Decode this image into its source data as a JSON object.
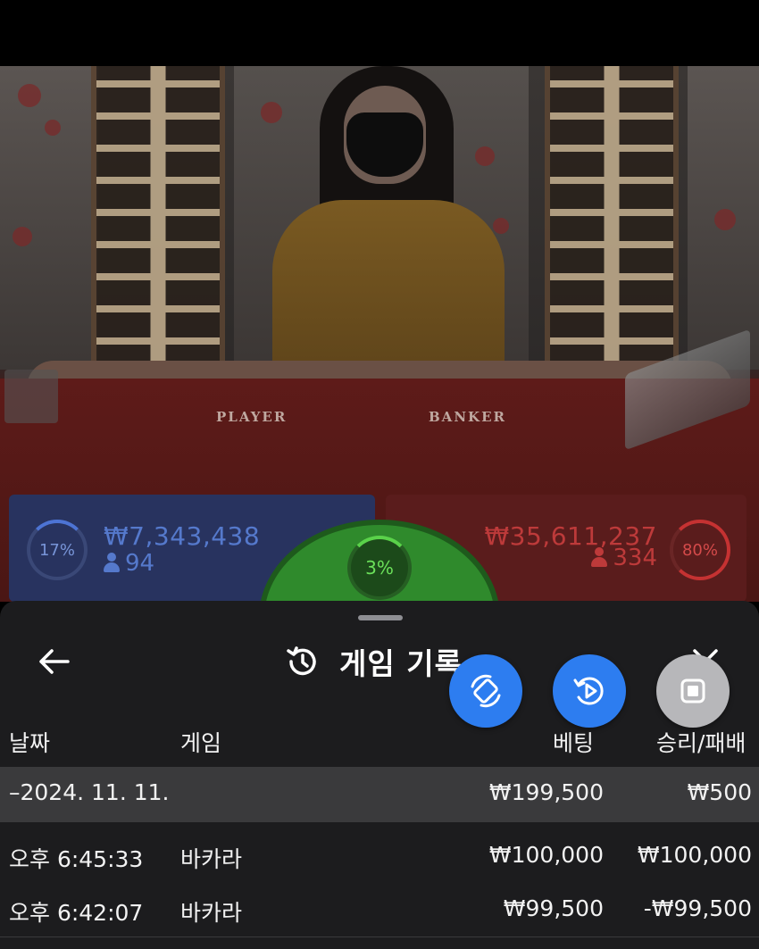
{
  "table": {
    "player_label": "PLAYER",
    "banker_label": "BANKER"
  },
  "bets": {
    "player": {
      "percent_label": "17%",
      "percent": 17,
      "amount": "₩7,343,438",
      "players": "94",
      "color": "#5579cc"
    },
    "tie": {
      "percent_label": "3%",
      "percent": 3,
      "color": "#6be05a"
    },
    "banker": {
      "percent_label": "80%",
      "percent": 80,
      "amount": "₩35,611,237",
      "players": "334",
      "color": "#bd3a3a"
    }
  },
  "sheet": {
    "title": "게임 기록",
    "icons": {
      "back": "arrow-left-icon",
      "history": "history-icon",
      "close": "close-icon",
      "fab1": "rotate-device-icon",
      "fab2": "replay-video-icon",
      "fab3": "stop-icon"
    },
    "columns": {
      "date": "날짜",
      "game": "게임",
      "bet": "베팅",
      "result": "승리/패배"
    },
    "date_row": {
      "date": "–2024. 11. 11.",
      "bet": "₩199,500",
      "result": "₩500"
    },
    "rows": [
      {
        "time": "오후 6:45:33",
        "game": "바카라",
        "bet": "₩100,000",
        "result": "₩100,000"
      },
      {
        "time": "오후 6:42:07",
        "game": "바카라",
        "bet": "₩99,500",
        "result": "-₩99,500"
      }
    ]
  }
}
